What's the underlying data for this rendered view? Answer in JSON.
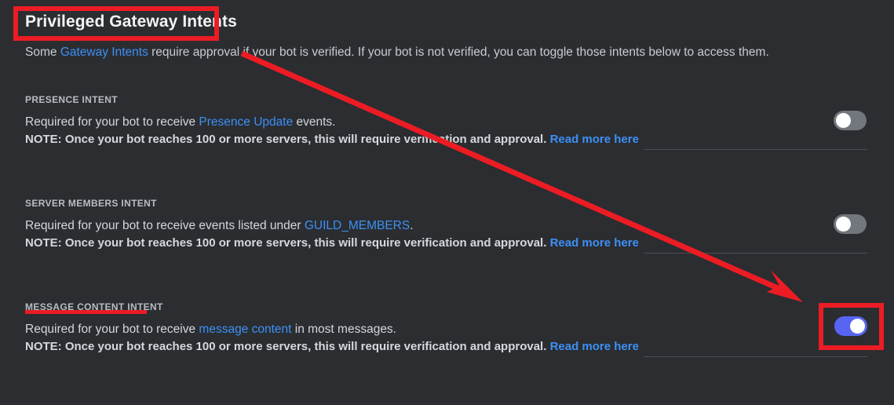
{
  "page": {
    "background_color": "#2b2d31",
    "title": "Privileged Gateway Intents",
    "subtitle_prefix": "Some ",
    "subtitle_link": "Gateway Intents",
    "subtitle_suffix": " require approval if your bot is verified. If your bot is not verified, you can toggle those intents below to access them."
  },
  "colors": {
    "link": "#3d90f5",
    "toggle_on": "#5865f2",
    "toggle_off": "#72767d",
    "annotation_red": "#ec1c24",
    "text_primary": "#f2f3f5",
    "text_secondary": "#c7ccd1",
    "divider": "#4a4d52"
  },
  "intents": [
    {
      "label": "PRESENCE INTENT",
      "desc_prefix": "Required for your bot to receive ",
      "desc_link": "Presence Update",
      "desc_suffix": " events.",
      "note_text": "NOTE: Once your bot reaches 100 or more servers, this will require verification and approval. ",
      "note_link": "Read more here",
      "toggle_state": "off",
      "toggle_label": "Presence Intent toggle"
    },
    {
      "label": "SERVER MEMBERS INTENT",
      "desc_prefix": "Required for your bot to receive events listed under ",
      "desc_link": "GUILD_MEMBERS",
      "desc_suffix": ".",
      "note_text": "NOTE: Once your bot reaches 100 or more servers, this will require verification and approval. ",
      "note_link": "Read more here",
      "toggle_state": "off",
      "toggle_label": "Server Members Intent toggle"
    },
    {
      "label": "MESSAGE CONTENT INTENT",
      "desc_prefix": "Required for your bot to receive ",
      "desc_link": "message content",
      "desc_suffix": " in most messages.",
      "note_text": "NOTE: Once your bot reaches 100 or more servers, this will require verification and approval. ",
      "note_link": "Read more here",
      "toggle_state": "on",
      "toggle_label": "Message Content Intent toggle"
    }
  ],
  "annotations": {
    "title_box": "red rectangle highlighting the Privileged Gateway Intents heading",
    "underline": "red underline beneath MESSAGE CONTENT INTENT",
    "toggle_box": "red rectangle highlighting the enabled Message Content Intent toggle",
    "arrow": "red arrow pointing from the heading down to the Message Content Intent toggle"
  }
}
